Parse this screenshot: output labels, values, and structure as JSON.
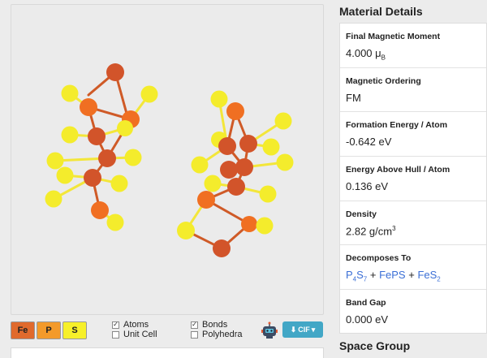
{
  "legend": [
    {
      "symbol": "Fe",
      "color": "#e06a2d"
    },
    {
      "symbol": "P",
      "color": "#f39a2a"
    },
    {
      "symbol": "S",
      "color": "#f7f029"
    }
  ],
  "options": {
    "atoms": {
      "label": "Atoms",
      "checked": true
    },
    "unit_cell": {
      "label": "Unit Cell",
      "checked": false
    },
    "bonds": {
      "label": "Bonds",
      "checked": true
    },
    "polyhedra": {
      "label": "Polyhedra",
      "checked": false
    }
  },
  "export_button": {
    "label": "CIF"
  },
  "details_title": "Material Details",
  "details": {
    "magnetic_moment": {
      "label": "Final Magnetic Moment",
      "value": "4.000",
      "unit": "μ",
      "unit_sub": "B"
    },
    "magnetic_ordering": {
      "label": "Magnetic Ordering",
      "value": "FM"
    },
    "formation_energy": {
      "label": "Formation Energy / Atom",
      "value": "-0.642 eV"
    },
    "energy_above_hull": {
      "label": "Energy Above Hull / Atom",
      "value": "0.136 eV"
    },
    "density": {
      "label": "Density",
      "value": "2.82 g/cm",
      "sup": "3"
    },
    "decomposes_to": {
      "label": "Decomposes To",
      "items": [
        {
          "a": "P",
          "a_sub": "4",
          "b": "S",
          "b_sub": "7"
        },
        {
          "text": "FePS"
        },
        {
          "a": "FeS",
          "a_sub": "2"
        }
      ],
      "separator": "+"
    },
    "band_gap": {
      "label": "Band Gap",
      "value": "0.000 eV"
    }
  },
  "space_group_title": "Space Group",
  "colors": {
    "fe": "#d2542a",
    "p": "#f3951f",
    "s": "#f4ec2c",
    "bond_fe": "#cf5a27",
    "bond_s": "#f3e63a",
    "link": "#3b6fd6",
    "cif": "#42a7c6"
  }
}
